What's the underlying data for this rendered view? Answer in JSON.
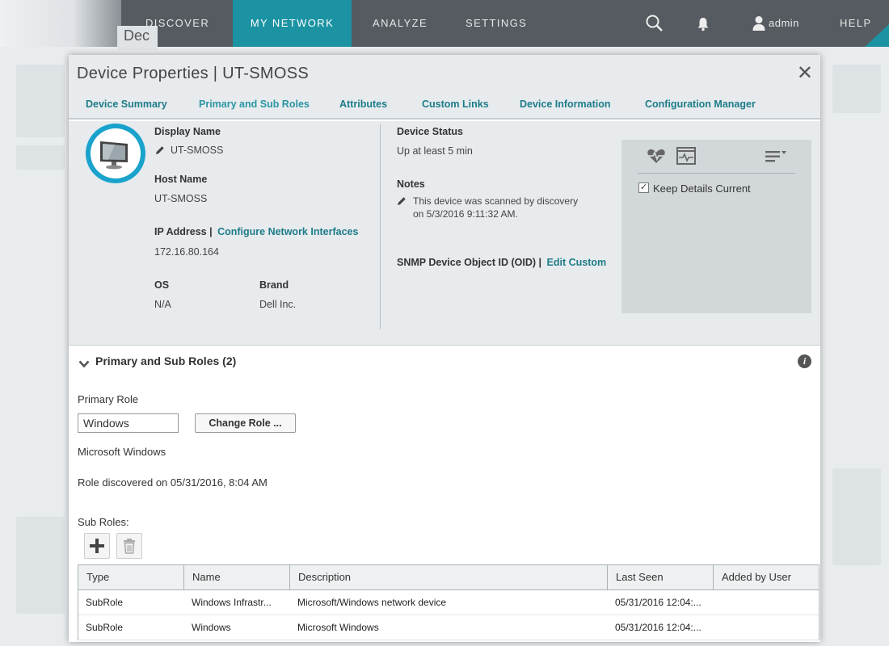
{
  "nav": {
    "discover": "DISCOVER",
    "my_network": "MY NETWORK",
    "analyze": "ANALYZE",
    "settings": "SETTINGS",
    "user": "admin",
    "help": "HELP",
    "behind_tab": "Dec"
  },
  "modal": {
    "title": "Device Properties | UT-SMOSS",
    "tabs": [
      "Device Summary",
      "Primary and Sub Roles",
      "Attributes",
      "Custom Links",
      "Device Information",
      "Configuration Manager"
    ]
  },
  "props": {
    "display_name_label": "Display Name",
    "display_name": "UT-SMOSS",
    "host_name_label": "Host Name",
    "host_name": "UT-SMOSS",
    "ip_label": "IP Address |",
    "ip_link": "Configure Network Interfaces",
    "ip": "172.16.80.164",
    "os_label": "OS",
    "os": "N/A",
    "brand_label": "Brand",
    "brand": "Dell Inc.",
    "status_label": "Device Status",
    "status": "Up at least 5 min",
    "notes_label": "Notes",
    "notes_line1": "This device was scanned by discovery",
    "notes_line2": "on 5/3/2016 9:11:32 AM.",
    "oid_label": "SNMP Device Object ID (OID) |",
    "oid_link": "Edit Custom",
    "keep_current": "Keep Details Current",
    "keep_current_checked": true
  },
  "roles": {
    "section_title": "Primary and Sub Roles (2)",
    "primary_role_label": "Primary Role",
    "primary_role_value": "Windows",
    "change_role": "Change Role ...",
    "role_desc": "Microsoft Windows",
    "discovered": "Role discovered on 05/31/2016, 8:04 AM",
    "sub_roles_label": "Sub Roles:"
  },
  "table": {
    "columns": [
      "Type",
      "Name",
      "Description",
      "Last Seen",
      "Added by User"
    ],
    "rows": [
      [
        "SubRole",
        "Windows Infrastr...",
        "Microsoft/Windows network device",
        "05/31/2016 12:04:...",
        ""
      ],
      [
        "SubRole",
        "Windows",
        "Microsoft Windows",
        "05/31/2016 12:04:...",
        ""
      ]
    ]
  },
  "colors": {
    "accent": "#1b93a3",
    "nav_bg": "#555b60",
    "link": "#1d7b89"
  }
}
